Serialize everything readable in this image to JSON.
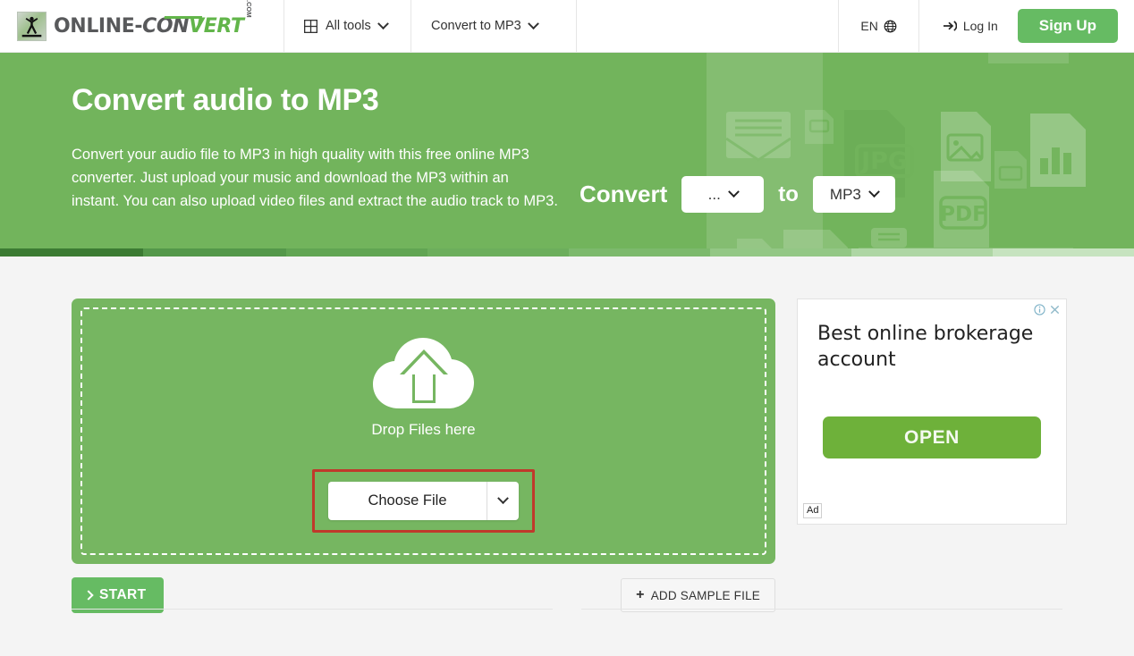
{
  "header": {
    "logo": {
      "part_a": "ONLINE-",
      "part_b": "CON",
      "part_c": "VERT",
      "dotcom": ".COM",
      "icon": "person-figure-logo-icon"
    },
    "nav": [
      {
        "label": "All tools",
        "icon": "grid-icon",
        "caret": "chevron-down-icon"
      },
      {
        "label": "Convert to MP3",
        "caret": "chevron-down-icon"
      }
    ],
    "language": {
      "label": "EN",
      "icon": "globe-icon"
    },
    "login": {
      "label": "Log In",
      "icon": "login-arrow-icon"
    },
    "signup": {
      "label": "Sign Up"
    }
  },
  "hero": {
    "title": "Convert audio to MP3",
    "description": "Convert your audio file to MP3 in high quality with this free online MP3 converter. Just upload your music and download the MP3 within an instant. You can also upload video files and extract the audio track to MP3.",
    "convert_label": "Convert",
    "to_label": "to",
    "source_format": "...",
    "target_format": "MP3",
    "background_icons": [
      "envelope-icon",
      "gif-file-icon",
      "jpg-file-icon",
      "image-file-icon",
      "tiff-file-icon",
      "chart-file-icon",
      "pdf-file-icon",
      "printer-icon",
      "png-file-icon",
      "line-chart-file-icon",
      "mov-file-icon",
      "tiff-file-icon-2",
      "text-aa-file-icon"
    ],
    "bg_color": "#72b45c",
    "strip_colors": [
      "#3c7b33",
      "#54984a",
      "#61a553",
      "#6cae5c",
      "#7cb96c",
      "#93c785",
      "#aed6a4",
      "#c6e3bf"
    ]
  },
  "main": {
    "dropzone": {
      "icon": "cloud-upload-icon",
      "label": "Drop Files here",
      "choose_file": "Choose File",
      "choose_caret": "chevron-down-icon",
      "highlight_color": "#c0392b",
      "bg_color": "#76b661"
    },
    "start_button": {
      "label": "START",
      "icon": "chevron-right-icon",
      "color": "#66bb63"
    },
    "sample_button": {
      "label": "ADD SAMPLE FILE",
      "icon": "plus-icon"
    }
  },
  "ad": {
    "title": "Best online brokerage account",
    "button": "OPEN",
    "tag": "Ad",
    "info_icon": "info-icon",
    "close_icon": "close-icon",
    "button_color": "#6eb13a"
  }
}
